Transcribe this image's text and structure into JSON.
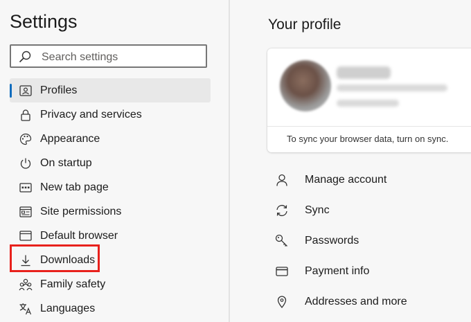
{
  "sidebar": {
    "title": "Settings",
    "search_placeholder": "Search settings",
    "items": [
      {
        "label": "Profiles",
        "icon": "profile-card-icon",
        "active": true
      },
      {
        "label": "Privacy and services",
        "icon": "lock-icon"
      },
      {
        "label": "Appearance",
        "icon": "palette-icon"
      },
      {
        "label": "On startup",
        "icon": "power-icon"
      },
      {
        "label": "New tab page",
        "icon": "new-tab-icon"
      },
      {
        "label": "Site permissions",
        "icon": "site-permissions-icon"
      },
      {
        "label": "Default browser",
        "icon": "browser-window-icon"
      },
      {
        "label": "Downloads",
        "icon": "download-icon",
        "highlighted": true
      },
      {
        "label": "Family safety",
        "icon": "family-icon"
      },
      {
        "label": "Languages",
        "icon": "language-icon"
      }
    ]
  },
  "main": {
    "title": "Your profile",
    "card": {
      "sync_note": "To sync your browser data, turn on sync."
    },
    "links": [
      {
        "label": "Manage account",
        "icon": "person-icon"
      },
      {
        "label": "Sync",
        "icon": "sync-icon"
      },
      {
        "label": "Passwords",
        "icon": "key-icon"
      },
      {
        "label": "Payment info",
        "icon": "card-icon"
      },
      {
        "label": "Addresses and more",
        "icon": "location-pin-icon"
      }
    ]
  },
  "colors": {
    "accent": "#0f6cbd",
    "highlight": "#e8211c",
    "background": "#f7f7f7"
  }
}
